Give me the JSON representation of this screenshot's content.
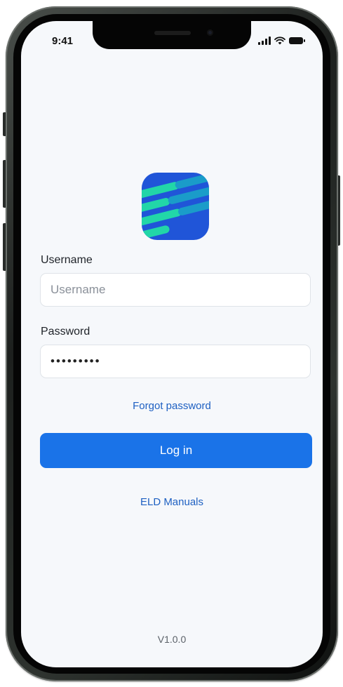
{
  "status_bar": {
    "time": "9:41",
    "icons": [
      "signal-icon",
      "wifi-icon",
      "battery-icon"
    ]
  },
  "logo": {
    "icon": "app-logo",
    "colors": {
      "background": "#2055d8",
      "stripe_light": "#22d6a8",
      "stripe_dark": "#1a9cc9"
    }
  },
  "form": {
    "username_label": "Username",
    "username_placeholder": "Username",
    "username_value": "",
    "password_label": "Password",
    "password_value": "•••••••••",
    "forgot_password": "Forgot password",
    "login_button": "Log in"
  },
  "links": {
    "eld_manuals": "ELD Manuals"
  },
  "footer": {
    "version": "V1.0.0"
  },
  "colors": {
    "accent": "#1a73e8",
    "link": "#1e60c2",
    "screen_background": "#f6f8fb"
  }
}
